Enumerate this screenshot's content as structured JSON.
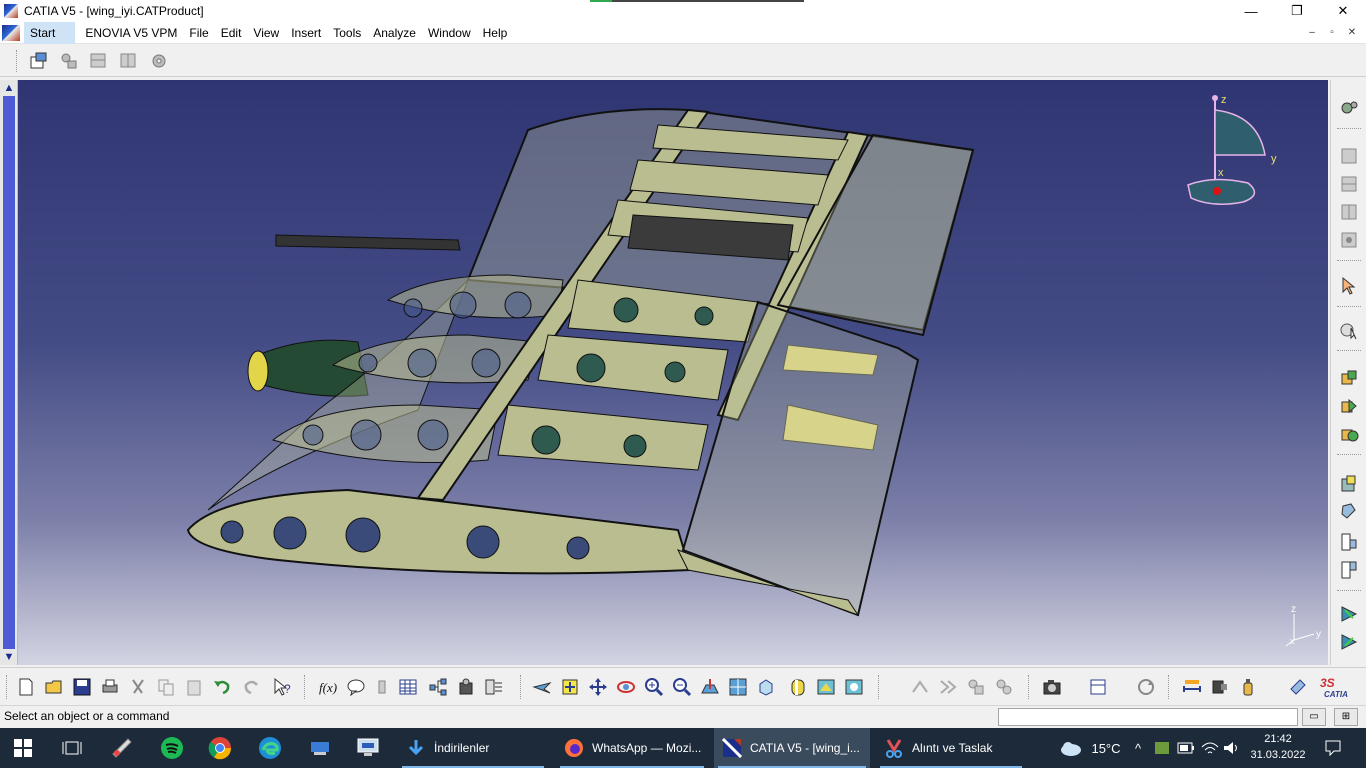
{
  "window": {
    "title": "CATIA V5 - [wing_iyi.CATProduct]",
    "minimize": "—",
    "maximize": "❐",
    "close": "✕"
  },
  "menubar": {
    "items": [
      "Start",
      "ENOVIA V5 VPM",
      "File",
      "Edit",
      "View",
      "Insert",
      "Tools",
      "Analyze",
      "Window",
      "Help"
    ],
    "mdi_min": "–",
    "mdi_restore": "▫",
    "mdi_close": "✕"
  },
  "compass": {
    "z": "z",
    "y": "y",
    "x": "x"
  },
  "axis_triad": {
    "z": "z",
    "y": "y",
    "x": "x"
  },
  "colors": {
    "wing_fill": "#b9bd8f",
    "wing_stroke": "#0d0d0d",
    "background_top": "#2f3572",
    "background_bottom": "#d3d4e2",
    "compass": "#2f5f6e",
    "taskbar": "#1c2a3a"
  },
  "statusbar": {
    "message": "Select an object or a command",
    "command_input_value": ""
  },
  "taskbar": {
    "apps": [
      {
        "icon": "windows-start-icon"
      },
      {
        "icon": "task-view-icon"
      },
      {
        "icon": "paint-icon"
      },
      {
        "icon": "spotify-icon"
      },
      {
        "icon": "chrome-icon"
      },
      {
        "icon": "edge-icon"
      },
      {
        "icon": "app-icon"
      },
      {
        "icon": "remote-desktop-icon"
      }
    ],
    "windows": [
      {
        "label": "İndirilenler",
        "icon": "download-folder-icon"
      },
      {
        "label": "WhatsApp — Mozi...",
        "icon": "firefox-icon"
      },
      {
        "label": "CATIA V5 - [wing_i...",
        "icon": "catia-icon"
      },
      {
        "label": "Alıntı ve Taslak",
        "icon": "snip-sketch-icon"
      }
    ],
    "weather": "15°C",
    "time": "21:42",
    "date": "31.03.2022"
  }
}
